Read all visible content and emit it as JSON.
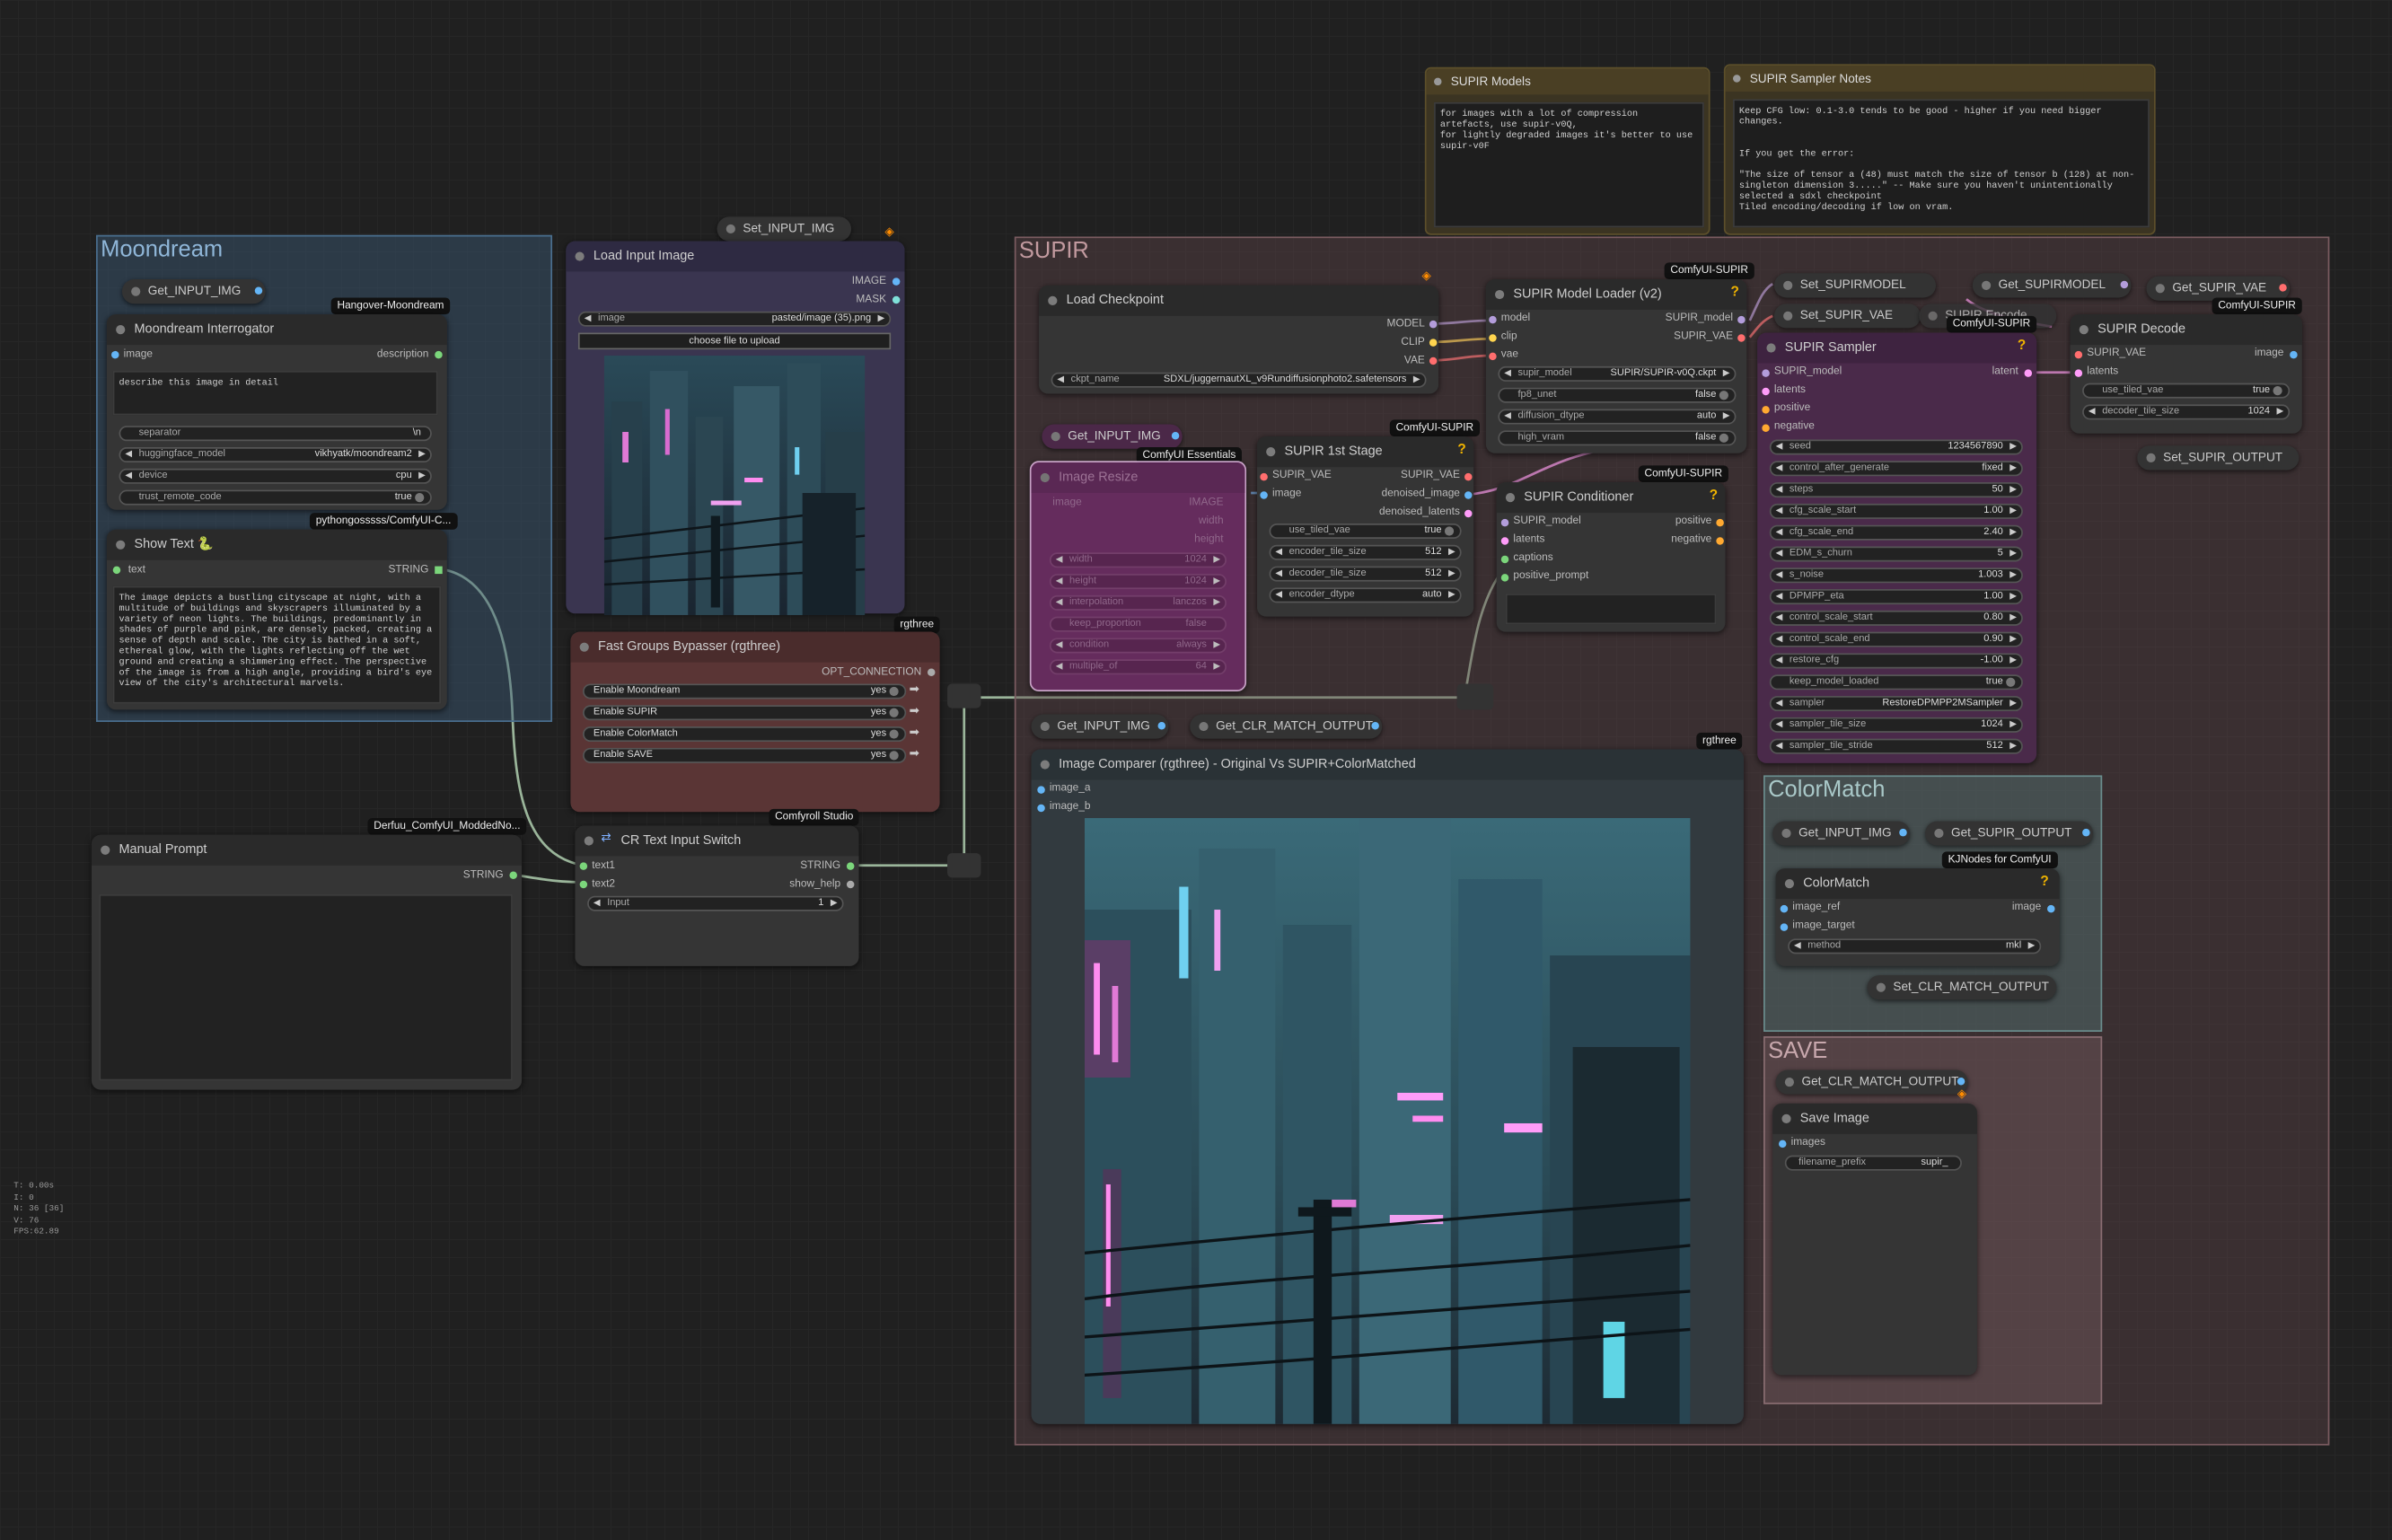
{
  "groups": {
    "moondream": "Moondream",
    "supir": "SUPIR",
    "colormatch": "ColorMatch",
    "save": "SAVE"
  },
  "notes": {
    "supir_models": {
      "title": "SUPIR Models",
      "text": "for images with a lot of compression artefacts, use supir-v0Q,\nfor lightly degraded images it's better to use supir-v0F"
    },
    "sampler_notes": {
      "title": "SUPIR Sampler Notes",
      "text": "Keep CFG low: 0.1-3.0 tends to be good - higher if you need bigger changes.\n\n\nIf you get the error:\n\n\"The size of tensor a (48) must match the size of tensor b (128) at non-singleton dimension 3.....\" -- Make sure you haven't unintentionally selected a sdxl checkpoint\nTiled encoding/decoding if low on vram."
    }
  },
  "getset": {
    "get_input_moondream": "Get_INPUT_IMG",
    "set_input": "Set_INPUT_IMG",
    "get_input_supir": "Get_INPUT_IMG",
    "get_input_compare": "Get_INPUT_IMG",
    "get_clr_compare": "Get_CLR_MATCH_OUTPUT",
    "set_supirmodel": "Set_SUPIRMODEL",
    "get_supirmodel": "Get_SUPIRMODEL",
    "get_supir_vae": "Get_SUPIR_VAE",
    "set_supir_vae": "Set_SUPIR_VAE",
    "supir_encode": "SUPIR Encode",
    "set_supir_output": "Set_SUPIR_OUTPUT",
    "get_input_cm": "Get_INPUT_IMG",
    "get_supir_output_cm": "Get_SUPIR_OUTPUT",
    "set_clr_match": "Set_CLR_MATCH_OUTPUT",
    "get_clr_save": "Get_CLR_MATCH_OUTPUT"
  },
  "badges": {
    "hangover": "Hangover-Moondream",
    "pythongossss": "pythongosssss/ComfyUI-C...",
    "derfuu": "Derfuu_ComfyUI_ModdedNo...",
    "rgthree1": "rgthree",
    "comfyroll": "Comfyroll Studio",
    "rgthree2": "rgthree",
    "essentials": "ComfyUI Essentials",
    "supir1": "ComfyUI-SUPIR",
    "supir2": "ComfyUI-SUPIR",
    "supir3": "ComfyUI-SUPIR",
    "supir4": "ComfyUI-SUPIR",
    "supir5": "ComfyUI-SUPIR",
    "kjnodes": "KJNodes for ComfyUI"
  },
  "moondream_interrogator": {
    "title": "Moondream Interrogator",
    "in_image": "image",
    "out_description": "description",
    "prompt": "describe this image in detail",
    "widgets": [
      {
        "label": "separator",
        "value": "\\n"
      },
      {
        "label": "huggingface_model",
        "value": "vikhyatk/moondream2"
      },
      {
        "label": "device",
        "value": "cpu"
      },
      {
        "label": "trust_remote_code",
        "value": "true"
      }
    ]
  },
  "show_text": {
    "title": "Show Text 🐍",
    "in_text": "text",
    "out_string": "STRING",
    "content": "The image depicts a bustling cityscape at night, with a multitude of buildings and skyscrapers illuminated by a variety of neon lights. The buildings, predominantly in shades of purple and pink, are densely packed, creating a sense of depth and scale. The city is bathed in a soft, ethereal glow, with the lights reflecting off the wet ground and creating a shimmering effect. The perspective of the image is from a high angle, providing a bird's eye view of the city's architectural marvels."
  },
  "manual_prompt": {
    "title": "Manual Prompt",
    "out_string": "STRING"
  },
  "load_image": {
    "title": "Load Input Image",
    "out_image": "IMAGE",
    "out_mask": "MASK",
    "image_label": "image",
    "image_value": "pasted/image (35).png",
    "upload": "choose file to upload"
  },
  "bypasser": {
    "title": "Fast Groups Bypasser (rgthree)",
    "out": "OPT_CONNECTION",
    "items": [
      {
        "label": "Enable Moondream",
        "value": "yes"
      },
      {
        "label": "Enable SUPIR",
        "value": "yes"
      },
      {
        "label": "Enable ColorMatch",
        "value": "yes"
      },
      {
        "label": "Enable SAVE",
        "value": "yes"
      }
    ]
  },
  "switch": {
    "title": "CR Text Input Switch",
    "in1": "text1",
    "in2": "text2",
    "out1": "STRING",
    "out2": "show_help",
    "input_label": "Input",
    "input_value": "1"
  },
  "load_checkpoint": {
    "title": "Load Checkpoint",
    "outs": [
      "MODEL",
      "CLIP",
      "VAE"
    ],
    "ckpt_label": "ckpt_name",
    "ckpt_value": "SDXL/juggernautXL_v9Rundiffusionphoto2.safetensors"
  },
  "image_resize": {
    "title": "Image Resize",
    "in_image": "image",
    "outs": [
      "IMAGE",
      "width",
      "height"
    ],
    "widgets": [
      {
        "label": "width",
        "value": "1024"
      },
      {
        "label": "height",
        "value": "1024"
      },
      {
        "label": "interpolation",
        "value": "lanczos"
      },
      {
        "label": "keep_proportion",
        "value": "false"
      },
      {
        "label": "condition",
        "value": "always"
      },
      {
        "label": "multiple_of",
        "value": "64"
      }
    ]
  },
  "first_stage": {
    "title": "SUPIR 1st Stage",
    "ins": [
      "SUPIR_VAE",
      "image"
    ],
    "outs": [
      "SUPIR_VAE",
      "denoised_image",
      "denoised_latents"
    ],
    "widgets": [
      {
        "label": "use_tiled_vae",
        "value": "true"
      },
      {
        "label": "encoder_tile_size",
        "value": "512"
      },
      {
        "label": "decoder_tile_size",
        "value": "512"
      },
      {
        "label": "encoder_dtype",
        "value": "auto"
      }
    ]
  },
  "model_loader": {
    "title": "SUPIR Model Loader (v2)",
    "ins": [
      "model",
      "clip",
      "vae"
    ],
    "outs": [
      "SUPIR_model",
      "SUPIR_VAE"
    ],
    "widgets": [
      {
        "label": "supir_model",
        "value": "SUPIR/SUPIR-v0Q.ckpt"
      },
      {
        "label": "fp8_unet",
        "value": "false"
      },
      {
        "label": "diffusion_dtype",
        "value": "auto"
      },
      {
        "label": "high_vram",
        "value": "false"
      }
    ]
  },
  "conditioner": {
    "title": "SUPIR Conditioner",
    "ins": [
      "SUPIR_model",
      "latents",
      "captions",
      "positive_prompt"
    ],
    "outs": [
      "positive",
      "negative"
    ]
  },
  "sampler": {
    "title": "SUPIR Sampler",
    "ins": [
      "SUPIR_model",
      "latents",
      "positive",
      "negative"
    ],
    "out": "latent",
    "widgets": [
      {
        "label": "seed",
        "value": "1234567890"
      },
      {
        "label": "control_after_generate",
        "value": "fixed"
      },
      {
        "label": "steps",
        "value": "50"
      },
      {
        "label": "cfg_scale_start",
        "value": "1.00"
      },
      {
        "label": "cfg_scale_end",
        "value": "2.40"
      },
      {
        "label": "EDM_s_churn",
        "value": "5"
      },
      {
        "label": "s_noise",
        "value": "1.003"
      },
      {
        "label": "DPMPP_eta",
        "value": "1.00"
      },
      {
        "label": "control_scale_start",
        "value": "0.80"
      },
      {
        "label": "control_scale_end",
        "value": "0.90"
      },
      {
        "label": "restore_cfg",
        "value": "-1.00"
      },
      {
        "label": "keep_model_loaded",
        "value": "true"
      },
      {
        "label": "sampler",
        "value": "RestoreDPMPP2MSampler"
      },
      {
        "label": "sampler_tile_size",
        "value": "1024"
      },
      {
        "label": "sampler_tile_stride",
        "value": "512"
      }
    ]
  },
  "decode": {
    "title": "SUPIR Decode",
    "ins": [
      "SUPIR_VAE",
      "latents"
    ],
    "out": "image",
    "widgets": [
      {
        "label": "use_tiled_vae",
        "value": "true"
      },
      {
        "label": "decoder_tile_size",
        "value": "1024"
      }
    ]
  },
  "comparer": {
    "title": "Image Comparer (rgthree) - Original Vs SUPIR+ColorMatched",
    "ins": [
      "image_a",
      "image_b"
    ]
  },
  "colormatch_node": {
    "title": "ColorMatch",
    "ins": [
      "image_ref",
      "image_target"
    ],
    "out": "image",
    "method_label": "method",
    "method_value": "mkl"
  },
  "save_image": {
    "title": "Save Image",
    "in": "images",
    "prefix_label": "filename_prefix",
    "prefix_value": "supir_"
  },
  "stats": [
    "T: 0.00s",
    "I: 0",
    "N: 36 [36]",
    "V: 76",
    "FPS:62.89"
  ],
  "colors": {
    "image_slot": "#64b5f6",
    "string_slot": "#7bd67b",
    "model_slot": "#b39ddb",
    "clip_slot": "#ffd54f",
    "vae_slot": "#ff6e6e",
    "latent_slot": "#ff9cf9",
    "cond_slot": "#ffa931"
  }
}
